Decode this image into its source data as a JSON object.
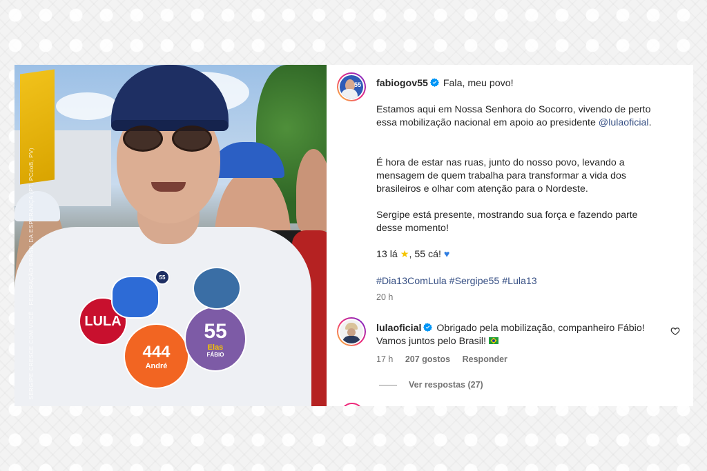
{
  "post": {
    "author": "fabiogov55",
    "greeting": "Fala, meu povo!",
    "para1": "Estamos aqui em Nossa Senhora do Socorro, vivendo de perto essa mobilização nacional em apoio ao presidente",
    "mention": "@lulaoficial",
    "period": ".",
    "para2": "É hora de estar nas ruas, junto do nosso povo, levando a mensagem de quem trabalha para transformar a vida dos brasileiros e olhar com atenção para o Nordeste.",
    "para3": "Sergipe está presente, mostrando sua força e fazendo parte desse momento!",
    "para4_pre": "13 lá",
    "para4_mid": ", 55 cá!",
    "hashtags": "#Dia13ComLula #Sergipe55 #Lula13",
    "time": "20 h"
  },
  "comment": {
    "author": "lulaoficial",
    "text": "Obrigado pela mobilização, companheiro Fábio! Vamos juntos pelo Brasil!",
    "time": "17 h",
    "likes": "207 gostos",
    "reply": "Responder",
    "view_replies": "Ver respostas (27)"
  },
  "media": {
    "cap_text": "55",
    "sticker_lula": "LULA",
    "sticker_55": "55",
    "sticker_elas": "Elas",
    "sticker_fabio": "FÁBIO",
    "sticker_andre": "André",
    "sticker_444": "444",
    "side_text": "SERGIPE CRESCE COM VOCÊ · FEDERAÇÃO BRASIL DA ESPERANÇA (PT, PCdoB, PV)"
  },
  "colors": {
    "link": "#385185",
    "verified": "#0095f6",
    "text": "#262626",
    "muted": "#737373"
  },
  "icons": {
    "verified": "verified-badge-icon",
    "star": "star-emoji-icon",
    "heart_blue": "blue-heart-emoji-icon",
    "flag": "brazil-flag-emoji-icon",
    "like": "heart-outline-icon"
  }
}
